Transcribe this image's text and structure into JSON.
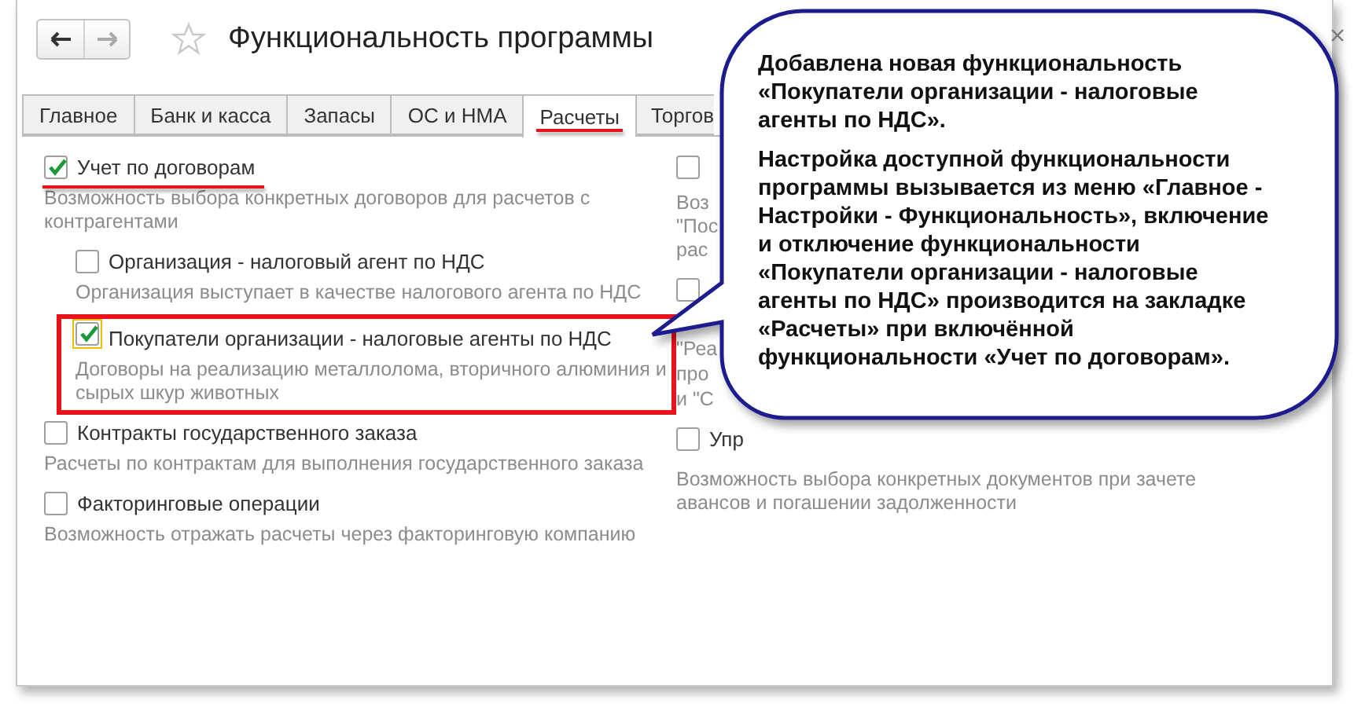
{
  "window": {
    "title": "Функциональность программы"
  },
  "tabs": [
    {
      "label": "Главное",
      "selected": false,
      "underlined": false
    },
    {
      "label": "Банк и касса",
      "selected": false,
      "underlined": false
    },
    {
      "label": "Запасы",
      "selected": false,
      "underlined": false
    },
    {
      "label": "ОС и НМА",
      "selected": false,
      "underlined": false
    },
    {
      "label": "Расчеты",
      "selected": true,
      "underlined": true
    },
    {
      "label": "Торгов",
      "selected": false,
      "underlined": false
    }
  ],
  "left_options": [
    {
      "label": "Учет по договорам",
      "checked": true,
      "underlined": true,
      "boxed": false,
      "description": "Возможность выбора конкретных договоров для расчетов с контрагентами",
      "children": [
        {
          "label": "Организация - налоговый агент по НДС",
          "checked": false,
          "underlined": false,
          "boxed": false,
          "description": "Организация выступает в качестве налогового агента по НДС"
        },
        {
          "label": "Покупатели организации - налоговые агенты по НДС",
          "checked": true,
          "focused": true,
          "underlined": false,
          "boxed": true,
          "description": "Договоры на реализацию металлолома, вторичного алюминия и сырых шкур животных"
        }
      ]
    },
    {
      "label": "Контракты государственного заказа",
      "checked": false,
      "underlined": false,
      "boxed": false,
      "description": "Расчеты по контрактам для выполнения государственного заказа"
    },
    {
      "label": "Факторинговые операции",
      "checked": false,
      "underlined": false,
      "boxed": false,
      "description": "Возможность отражать расчеты через факторинговую компанию"
    }
  ],
  "right_options": [
    {
      "checked": false,
      "description_lines": [
        "Воз",
        "\"Пос",
        "рас"
      ]
    },
    {
      "checked": false,
      "description_lines": [
        "\"Реа",
        "про",
        "и \"С"
      ]
    },
    {
      "checked": false,
      "label": "Упр",
      "description_lines": [
        "Возможность выбора конкретных документов при зачете",
        "авансов и погашении задолженности"
      ]
    }
  ],
  "callout": {
    "paragraphs": [
      "Добавлена новая функциональность «Покупатели организации - налоговые агенты по НДС».",
      "Настройка доступной функциональности программы вызывается из меню «Главное - Настройки - Функциональность», включение и отключение функциональности «Покупатели организации - налоговые агенты по НДС» производится на закладке «Расчеты» при включённой функциональности «Учет по договорам»."
    ]
  }
}
